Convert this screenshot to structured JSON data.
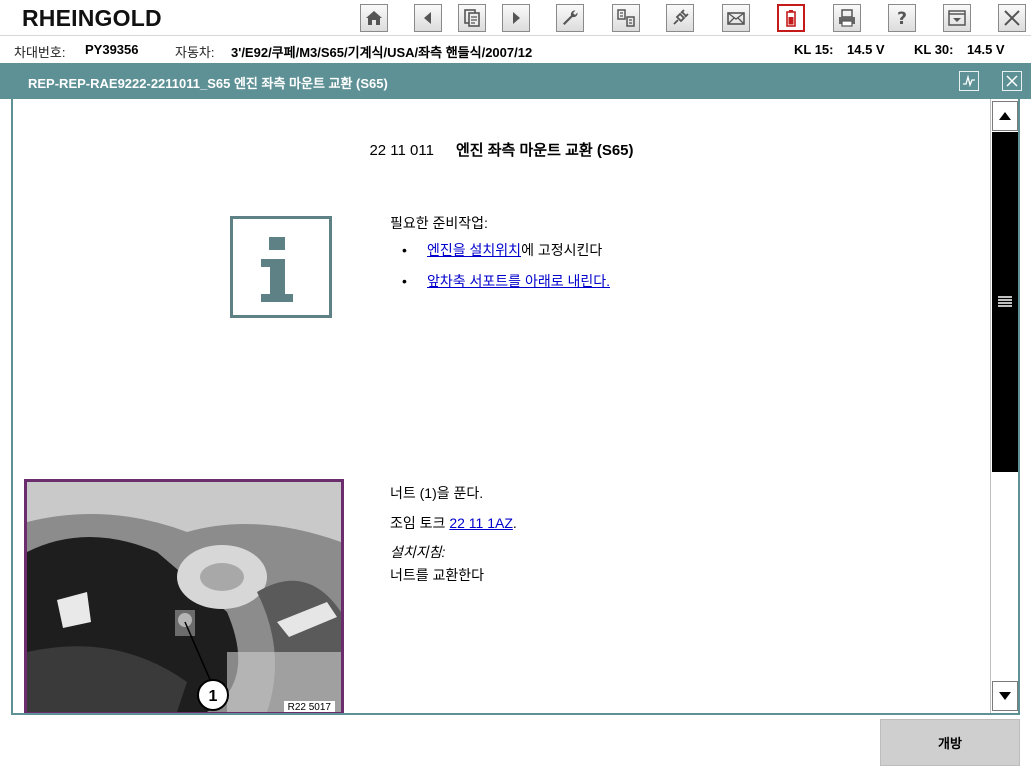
{
  "app": {
    "brand": "RHEINGOLD"
  },
  "toolbar": {
    "buttons": [
      {
        "name": "home-button",
        "icon": "home-icon"
      },
      {
        "name": "back-button",
        "icon": "triangle-left-icon"
      },
      {
        "name": "documents-button",
        "icon": "documents-icon"
      },
      {
        "name": "forward-button",
        "icon": "triangle-right-icon"
      },
      {
        "name": "service-button",
        "icon": "wrench-icon"
      },
      {
        "name": "translate-button",
        "icon": "translate-icon"
      },
      {
        "name": "connection-button",
        "icon": "plug-icon"
      },
      {
        "name": "mail-button",
        "icon": "envelope-icon"
      },
      {
        "name": "battery-button",
        "icon": "battery-icon",
        "active": true
      },
      {
        "name": "print-button",
        "icon": "printer-icon"
      },
      {
        "name": "help-button",
        "icon": "question-icon"
      },
      {
        "name": "menu-button",
        "icon": "dropdown-menu-icon"
      },
      {
        "name": "close-app-button",
        "icon": "close-icon"
      }
    ]
  },
  "vehicle": {
    "vin_label": "차대번호:",
    "vin_value": "PY39356",
    "car_label": "자동차:",
    "car_value": "3'/E92/쿠페/M3/S65/기계식/USA/좌측 핸들식/2007/12",
    "kl15_label": "KL 15:",
    "kl15_value": "14.5 V",
    "kl30_label": "KL 30:",
    "kl30_value": "14.5 V"
  },
  "document": {
    "title_bar": "REP-REP-RAE9222-2211011_S65 엔진 좌측 마운트 교환 (S65)",
    "heading_number": "22 11 011",
    "heading_name": "엔진 좌측 마운트 교환 (S65)",
    "prep_label": "필요한 준비작업:",
    "prep_items": [
      {
        "link": "엔진을 설치위치",
        "suffix": "에 고정시킨다"
      },
      {
        "link": "앞차축 서포트를 아래로 내린다.",
        "suffix": ""
      }
    ],
    "step_1": "너트 (1)을 푼다.",
    "torque_prefix": "조임 토크 ",
    "torque_link": "22 11 1AZ",
    "torque_suffix": ".",
    "install_note_label": "설치지침:",
    "install_note_text": "너트를 교환한다",
    "photo": {
      "callout": "1",
      "ref": "R22 5017"
    }
  },
  "footer": {
    "open_label": "개방"
  },
  "colors": {
    "accent": "#5e9196",
    "link": "#0000cc",
    "photo_border": "#6b2d6b",
    "active_border": "#c41a1a"
  }
}
